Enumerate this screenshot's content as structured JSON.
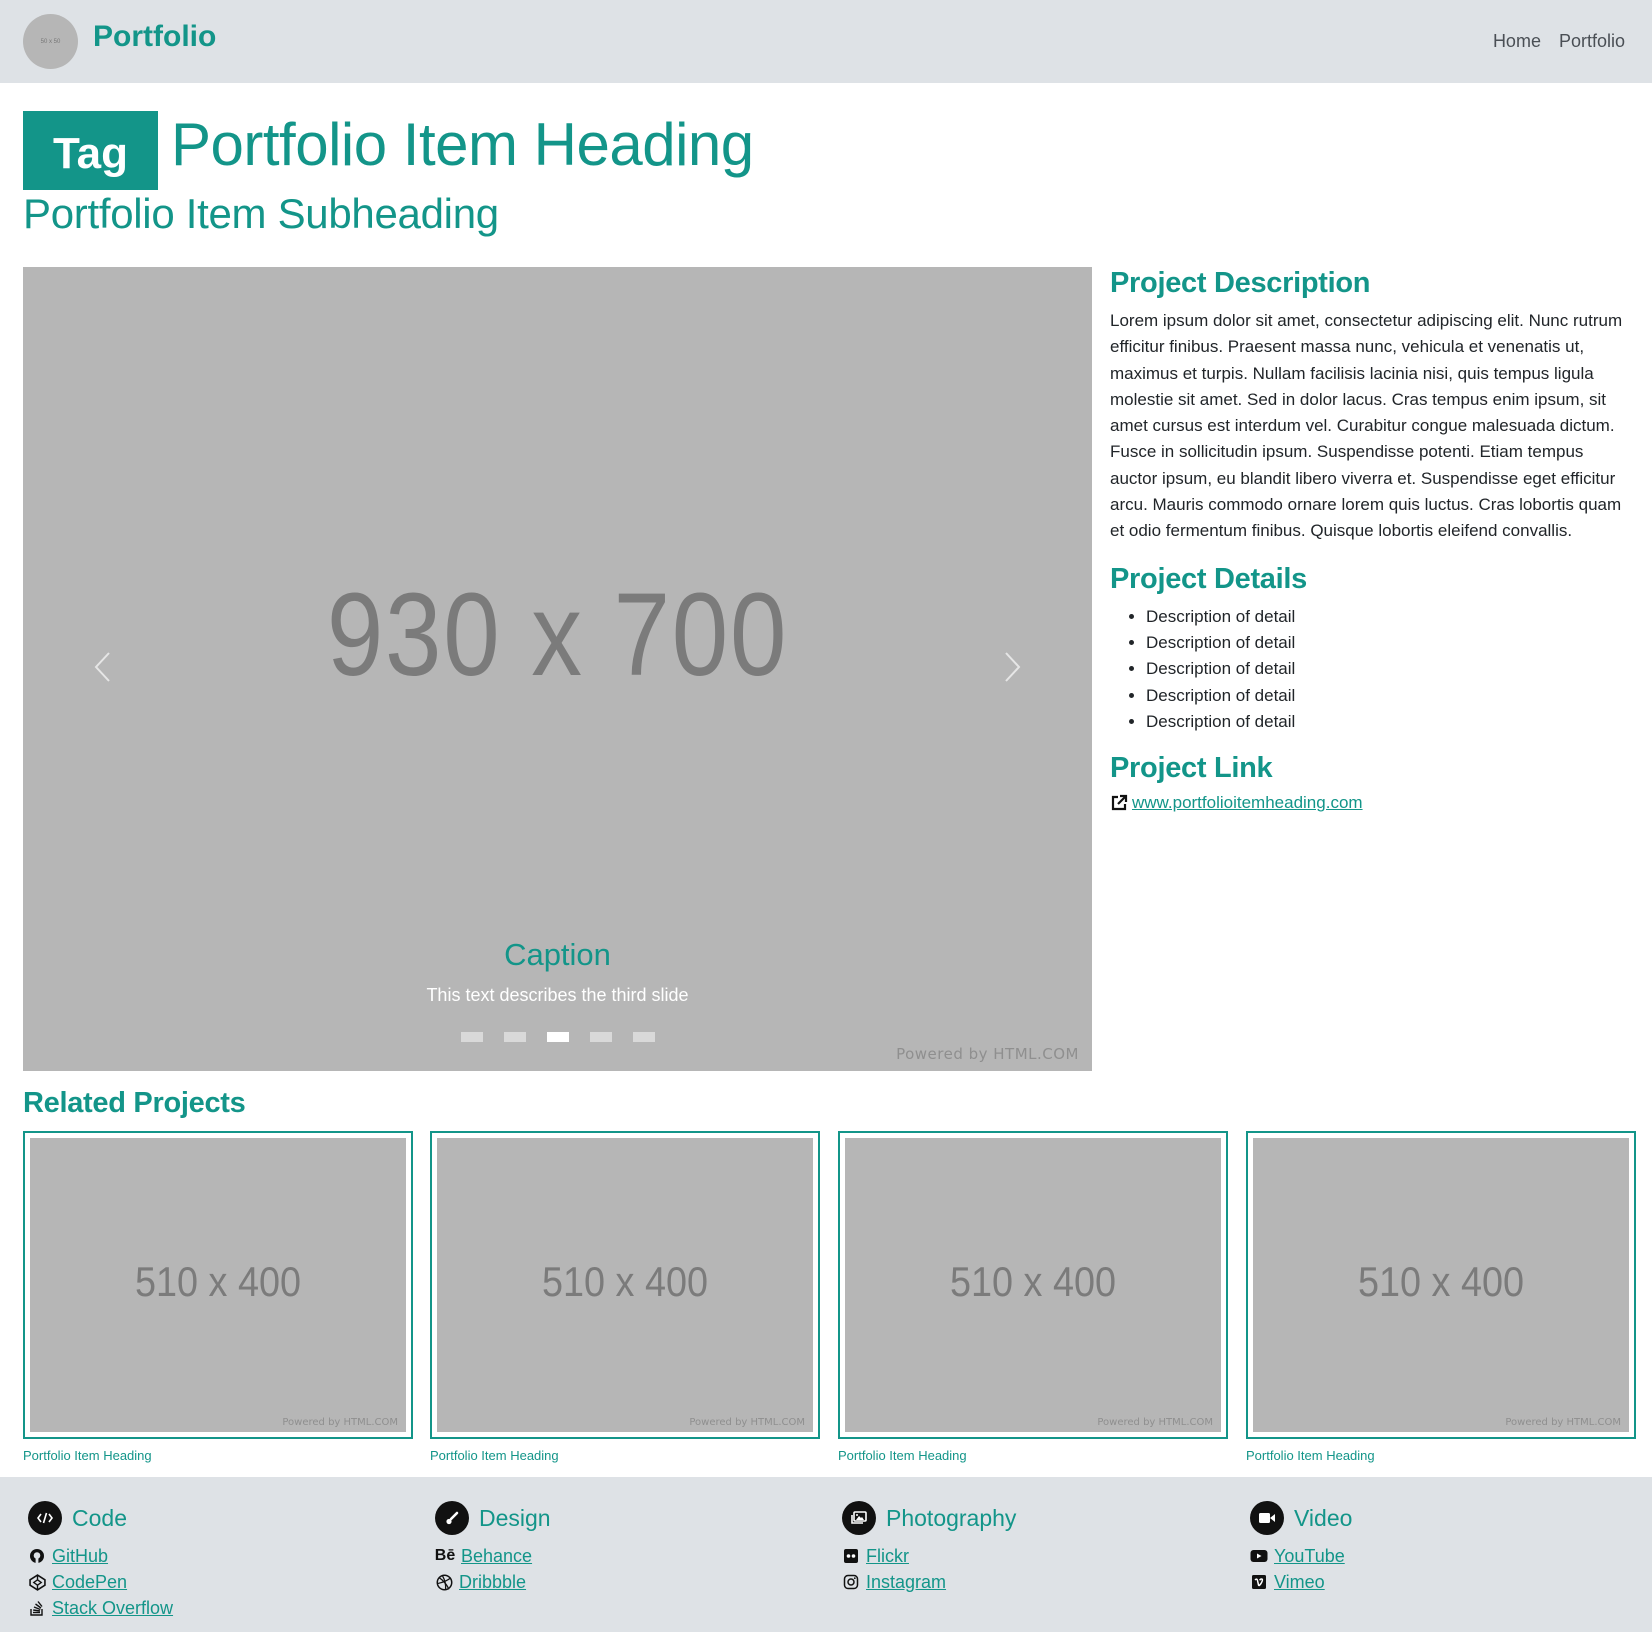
{
  "header": {
    "logo_text": "50 x 50",
    "brand": "Portfolio",
    "nav": [
      {
        "label": "Home"
      },
      {
        "label": "Portfolio"
      }
    ]
  },
  "title": {
    "tag": "Tag",
    "heading": "Portfolio Item Heading",
    "subheading": "Portfolio Item Subheading"
  },
  "carousel": {
    "placeholder": "930 x 700",
    "caption_title": "Caption",
    "caption_text": "This text describes the third slide",
    "slide_count": 5,
    "active_slide": 3,
    "powered_by": "Powered by HTML.COM"
  },
  "sidebar": {
    "description_title": "Project Description",
    "description": "Lorem ipsum dolor sit amet, consectetur adipiscing elit. Nunc rutrum efficitur finibus. Praesent massa nunc, vehicula et venenatis ut, maximus et turpis. Nullam facilisis lacinia nisi, quis tempus ligula molestie sit amet. Sed in dolor lacus. Cras tempus enim ipsum, sit amet cursus est interdum vel. Curabitur congue malesuada dictum. Fusce in sollicitudin ipsum. Suspendisse potenti. Etiam tempus auctor ipsum, eu blandit libero viverra et. Suspendisse eget efficitur arcu. Mauris commodo ornare lorem quis luctus. Cras lobortis quam et odio fermentum finibus. Quisque lobortis eleifend convallis.",
    "details_title": "Project Details",
    "details": [
      "Description of detail",
      "Description of detail",
      "Description of detail",
      "Description of detail",
      "Description of detail"
    ],
    "link_title": "Project Link",
    "link_text": "www.portfolioitemheading.com"
  },
  "related": {
    "title": "Related Projects",
    "items": [
      {
        "placeholder": "510 x 400",
        "powered_by": "Powered by HTML.COM",
        "caption": "Portfolio Item Heading"
      },
      {
        "placeholder": "510 x 400",
        "powered_by": "Powered by HTML.COM",
        "caption": "Portfolio Item Heading"
      },
      {
        "placeholder": "510 x 400",
        "powered_by": "Powered by HTML.COM",
        "caption": "Portfolio Item Heading"
      },
      {
        "placeholder": "510 x 400",
        "powered_by": "Powered by HTML.COM",
        "caption": "Portfolio Item Heading"
      }
    ]
  },
  "footer": {
    "columns": [
      {
        "title": "Code",
        "icon": "code-icon",
        "links": [
          {
            "label": "GitHub",
            "icon": "github-icon"
          },
          {
            "label": "CodePen",
            "icon": "codepen-icon"
          },
          {
            "label": "Stack Overflow",
            "icon": "stack-overflow-icon"
          }
        ]
      },
      {
        "title": "Design",
        "icon": "brush-icon",
        "links": [
          {
            "label": "Behance",
            "icon": "behance-icon"
          },
          {
            "label": "Dribbble",
            "icon": "dribbble-icon"
          }
        ]
      },
      {
        "title": "Photography",
        "icon": "images-icon",
        "links": [
          {
            "label": "Flickr",
            "icon": "flickr-icon"
          },
          {
            "label": "Instagram",
            "icon": "instagram-icon"
          }
        ]
      },
      {
        "title": "Video",
        "icon": "video-camera-icon",
        "links": [
          {
            "label": "YouTube",
            "icon": "youtube-icon"
          },
          {
            "label": "Vimeo",
            "icon": "vimeo-icon"
          }
        ]
      }
    ]
  },
  "colors": {
    "accent": "#139589",
    "header_bg": "#dee2e6",
    "placeholder_bg": "#b6b6b6"
  }
}
